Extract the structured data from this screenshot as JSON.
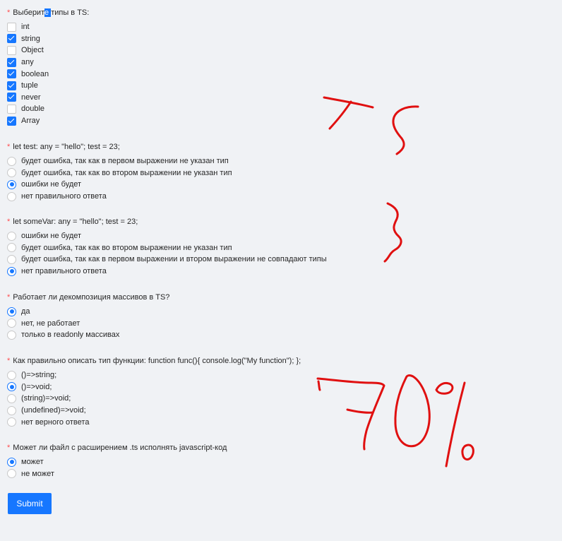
{
  "q1": {
    "title_pre": "Выберит",
    "title_hl": "е ",
    "title_post": "типы в TS:",
    "options": [
      {
        "label": "int",
        "checked": false
      },
      {
        "label": "string",
        "checked": true
      },
      {
        "label": "Object",
        "checked": false
      },
      {
        "label": "any",
        "checked": true
      },
      {
        "label": "boolean",
        "checked": true
      },
      {
        "label": "tuple",
        "checked": true
      },
      {
        "label": "never",
        "checked": true
      },
      {
        "label": "double",
        "checked": false
      },
      {
        "label": "Array",
        "checked": true
      }
    ]
  },
  "q2": {
    "title": "let test: any = \"hello\"; test = 23;",
    "options": [
      {
        "label": "будет ошибка, так как в первом выражении не указан тип",
        "selected": false
      },
      {
        "label": "будет ошибка, так как во втором выражении не указан тип",
        "selected": false
      },
      {
        "label": "ошибки не будет",
        "selected": true
      },
      {
        "label": "нет правильного ответа",
        "selected": false
      }
    ]
  },
  "q3": {
    "title": "let someVar: any = \"hello\"; test = 23;",
    "options": [
      {
        "label": "ошибки не будет",
        "selected": false
      },
      {
        "label": "будет ошибка, так как во втором выражении не указан тип",
        "selected": false
      },
      {
        "label": "будет ошибка, так как в первом выражении и втором выражении не совпадают типы",
        "selected": false
      },
      {
        "label": "нет правильного ответа",
        "selected": true
      }
    ]
  },
  "q4": {
    "title": "Работает ли декомпозиция массивов в TS?",
    "options": [
      {
        "label": "да",
        "selected": true
      },
      {
        "label": "нет, не работает",
        "selected": false
      },
      {
        "label": "только в readonly массивах",
        "selected": false
      }
    ]
  },
  "q5": {
    "title": "Как правильно описать тип функции: function func(){ console.log(\"My function\"); };",
    "options": [
      {
        "label": "()=>string;",
        "selected": false
      },
      {
        "label": "()=>void;",
        "selected": true
      },
      {
        "label": "(string)=>void;",
        "selected": false
      },
      {
        "label": "(undefined)=>void;",
        "selected": false
      },
      {
        "label": "нет верного ответа",
        "selected": false
      }
    ]
  },
  "q6": {
    "title": "Может ли файл с расширением .ts исполнять javascript-код",
    "options": [
      {
        "label": "может",
        "selected": true
      },
      {
        "label": "не может",
        "selected": false
      }
    ]
  },
  "required_mark": "*",
  "submit_label": "Submit",
  "colors": {
    "accent": "#1677ff",
    "required": "#ff4d4f",
    "ink": "#e01010",
    "background": "#f0f2f5"
  }
}
